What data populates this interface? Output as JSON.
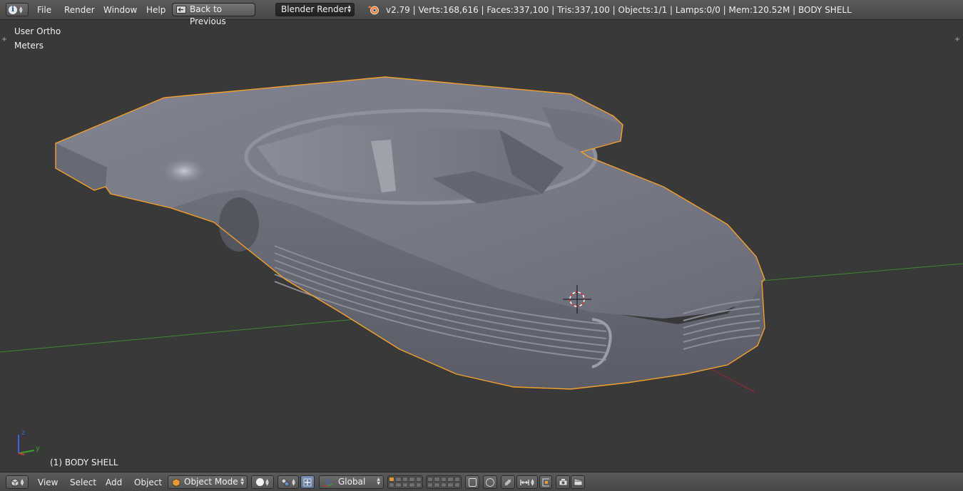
{
  "top_bar": {
    "menus": [
      "File",
      "Render",
      "Window",
      "Help"
    ],
    "back_button": "Back to Previous",
    "render_engine": "Blender Render",
    "stats": "v2.79 | Verts:168,616 | Faces:337,100 | Tris:337,100 | Objects:1/1 | Lamps:0/0 | Mem:120.52M | BODY SHELL"
  },
  "viewport": {
    "view_name": "User Ortho",
    "units": "Meters",
    "active_object": "(1) BODY SHELL",
    "axis_labels": {
      "z": "z",
      "y": "y"
    }
  },
  "bottom_bar": {
    "menus": [
      "View",
      "Select",
      "Add",
      "Object"
    ],
    "mode": "Object Mode",
    "orientation": "Global"
  },
  "colors": {
    "header_bg": "#4d4d4d",
    "viewport_bg": "#393939",
    "selection_outline": "#f2a12c",
    "x_axis": "#9a2b2b",
    "y_axis": "#3c8a2b",
    "mesh": "#7a7c8a"
  },
  "icons": [
    "info-icon",
    "blender-logo-icon",
    "cube-icon",
    "sphere-shading-icon",
    "pivot-icon",
    "manipulator-icon",
    "layers-icon",
    "lock-icon",
    "proportional-icon",
    "snap-icon",
    "camera-icon",
    "clapper-icon"
  ]
}
